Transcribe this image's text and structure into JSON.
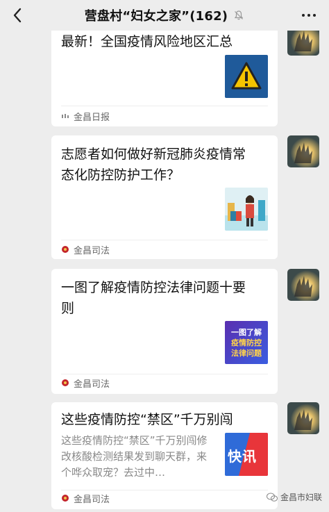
{
  "header": {
    "title": "营盘村“妇女之家”(162)",
    "back_icon": "chevron-left-icon",
    "mute_icon": "bell-muted-icon",
    "more_icon": "more-dots-icon"
  },
  "messages": [
    {
      "title": "最新！全国疫情风险地区汇总",
      "source": "金昌日报",
      "thumb": "warning-triangle-icon"
    },
    {
      "title": "志愿者如何做好新冠肺炎疫情常态化防控防护工作？",
      "source": "金昌司法",
      "thumb": "volunteer-illustration"
    },
    {
      "title": "一图了解疫情防控法律问题十要则",
      "source": "金昌司法",
      "thumb_lines": [
        "一图了解",
        "疫情防控",
        "法律问题"
      ]
    },
    {
      "title": "这些疫情防控“禁区”千万别闯",
      "desc": "这些疫情防控“禁区”千万别闯修改核酸检测结果发到聊天群，来个哗众取宠？去过中…",
      "source": "金昌司法",
      "thumb_text": "快讯"
    }
  ],
  "watermark": "金昌市妇联"
}
